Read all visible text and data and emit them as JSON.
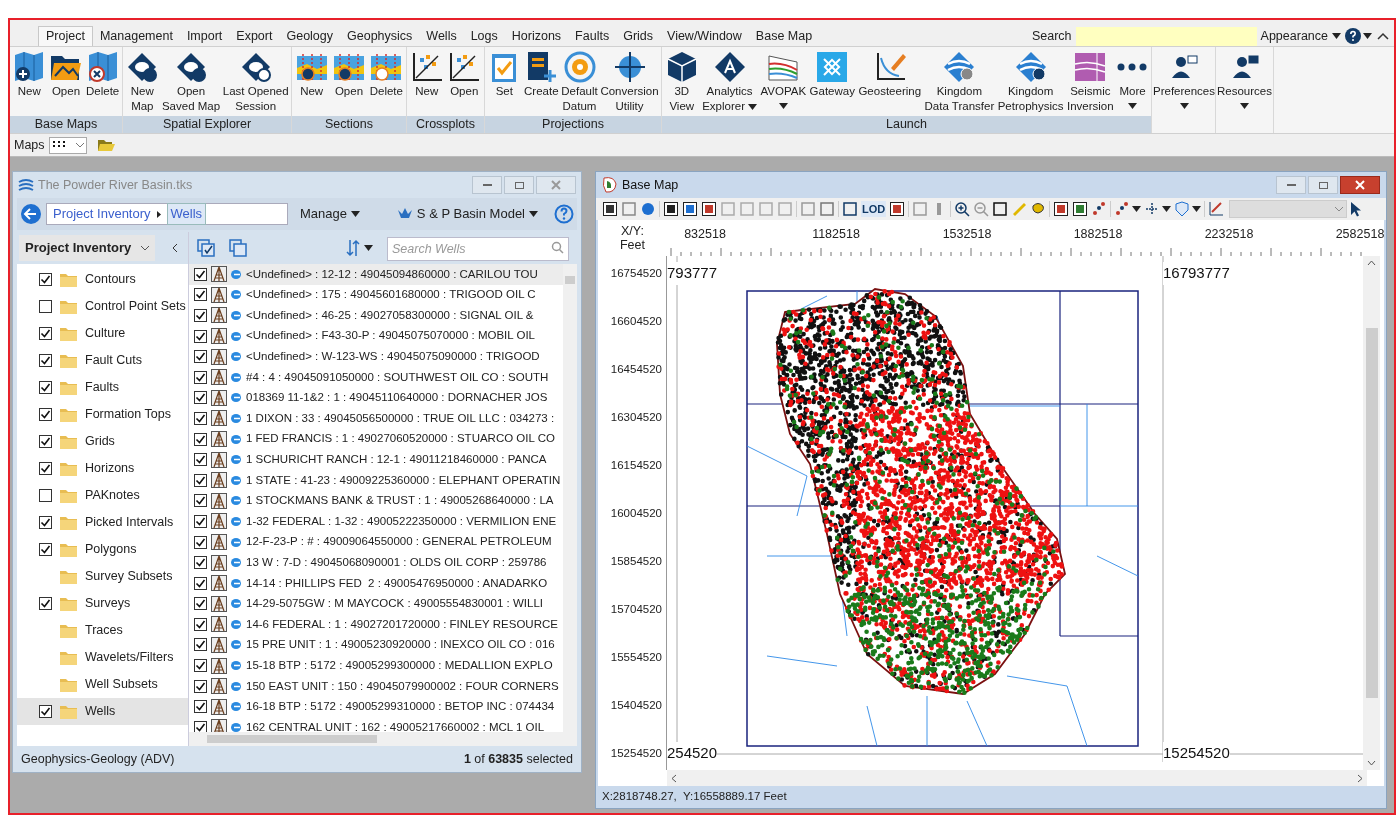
{
  "menu_tabs": [
    {
      "label": "Project",
      "selected": true
    },
    {
      "label": "Management",
      "selected": false
    },
    {
      "label": "Import",
      "selected": false
    },
    {
      "label": "Export",
      "selected": false
    },
    {
      "label": "Geology",
      "selected": false
    },
    {
      "label": "Geophysics",
      "selected": false
    },
    {
      "label": "Wells",
      "selected": false
    },
    {
      "label": "Logs",
      "selected": false
    },
    {
      "label": "Horizons",
      "selected": false
    },
    {
      "label": "Faults",
      "selected": false
    },
    {
      "label": "Grids",
      "selected": false
    },
    {
      "label": "View/Window",
      "selected": false
    },
    {
      "label": "Base Map",
      "selected": false
    }
  ],
  "search": {
    "label": "Search"
  },
  "appearance": "Appearance",
  "ribbon_groups": [
    {
      "label": "Base Maps",
      "buttons": [
        {
          "lines": [
            "New"
          ],
          "dropdown": false
        },
        {
          "lines": [
            "Open"
          ],
          "dropdown": false
        },
        {
          "lines": [
            "Delete"
          ],
          "dropdown": false
        }
      ]
    },
    {
      "label": "Spatial Explorer",
      "buttons": [
        {
          "lines": [
            "New",
            "Map"
          ],
          "dropdown": false
        },
        {
          "lines": [
            "Open",
            "Saved Map"
          ],
          "dropdown": false
        },
        {
          "lines": [
            "Last Opened",
            "Session"
          ],
          "dropdown": false
        }
      ]
    },
    {
      "label": "Sections",
      "buttons": [
        {
          "lines": [
            "New"
          ],
          "dropdown": false
        },
        {
          "lines": [
            "Open"
          ],
          "dropdown": false
        },
        {
          "lines": [
            "Delete"
          ],
          "dropdown": false
        }
      ]
    },
    {
      "label": "Crossplots",
      "buttons": [
        {
          "lines": [
            "New"
          ],
          "dropdown": false
        },
        {
          "lines": [
            "Open"
          ],
          "dropdown": false
        }
      ]
    },
    {
      "label": "Projections",
      "buttons": [
        {
          "lines": [
            "Set"
          ],
          "dropdown": false
        },
        {
          "lines": [
            "Create"
          ],
          "dropdown": false
        },
        {
          "lines": [
            "Default",
            "Datum"
          ],
          "dropdown": false
        },
        {
          "lines": [
            "Conversion",
            "Utility"
          ],
          "dropdown": false
        }
      ]
    },
    {
      "label": "Launch",
      "buttons": [
        {
          "lines": [
            "3D",
            "View"
          ],
          "dropdown": false
        },
        {
          "lines": [
            "Analytics",
            "Explorer"
          ],
          "dropdown": true
        },
        {
          "lines": [
            "AVOPAK"
          ],
          "dropdown": true
        },
        {
          "lines": [
            "Gateway"
          ],
          "dropdown": false
        },
        {
          "lines": [
            "Geosteering"
          ],
          "dropdown": false
        },
        {
          "lines": [
            "Kingdom",
            "Data Transfer"
          ],
          "dropdown": false
        },
        {
          "lines": [
            "Kingdom",
            "Petrophysics"
          ],
          "dropdown": false
        },
        {
          "lines": [
            "Seismic",
            "Inversion"
          ],
          "dropdown": false
        },
        {
          "lines": [
            "More"
          ],
          "dropdown": true
        }
      ]
    },
    {
      "buttons": [
        {
          "lines": [
            "Preferences"
          ],
          "dropdown": true
        }
      ]
    },
    {
      "buttons": [
        {
          "lines": [
            "Resources"
          ],
          "dropdown": true
        }
      ]
    }
  ],
  "maps_bar": {
    "label": "Maps"
  },
  "inventory_window": {
    "title": "The Powder River Basin.tks",
    "breadcrumb": [
      "Project Inventory",
      "Wells"
    ],
    "manage": "Manage",
    "model": "S & P Basin Model",
    "tree_header": "Project Inventory",
    "search_placeholder": "Search Wells",
    "categories": [
      {
        "label": "Contours",
        "kind": "checkbox",
        "checked": true,
        "selected": false
      },
      {
        "label": "Control Point Sets",
        "kind": "checkbox",
        "checked": false,
        "selected": false
      },
      {
        "label": "Culture",
        "kind": "checkbox",
        "checked": true,
        "selected": false
      },
      {
        "label": "Fault Cuts",
        "kind": "checkbox",
        "checked": true,
        "selected": false
      },
      {
        "label": "Faults",
        "kind": "checkbox",
        "checked": true,
        "selected": false
      },
      {
        "label": "Formation Tops",
        "kind": "checkbox",
        "checked": true,
        "selected": false
      },
      {
        "label": "Grids",
        "kind": "checkbox",
        "checked": true,
        "selected": false
      },
      {
        "label": "Horizons",
        "kind": "checkbox",
        "checked": true,
        "selected": false
      },
      {
        "label": "PAKnotes",
        "kind": "checkbox",
        "checked": false,
        "selected": false
      },
      {
        "label": "Picked Intervals",
        "kind": "checkbox",
        "checked": true,
        "selected": false
      },
      {
        "label": "Polygons",
        "kind": "checkbox",
        "checked": true,
        "selected": false
      },
      {
        "label": "Survey Subsets",
        "kind": "plain",
        "selected": false
      },
      {
        "label": "Surveys",
        "kind": "checkbox",
        "checked": true,
        "selected": false
      },
      {
        "label": "Traces",
        "kind": "plain",
        "selected": false
      },
      {
        "label": "Wavelets/Filters",
        "kind": "plain",
        "selected": false
      },
      {
        "label": "Well Subsets",
        "kind": "plain",
        "selected": false
      },
      {
        "label": "Wells",
        "kind": "checkbox",
        "checked": true,
        "selected": true
      }
    ],
    "wells": [
      {
        "text": "<Undefined> : 12-12 : 49045094860000 : CARILOU TOU",
        "checked": true,
        "selected": true
      },
      {
        "text": "<Undefined> : 175 : 49045601680000 : TRIGOOD OIL C",
        "checked": true,
        "selected": false
      },
      {
        "text": "<Undefined> : 46-25 : 49027058300000 : SIGNAL OIL &",
        "checked": true,
        "selected": false
      },
      {
        "text": "<Undefined> : F43-30-P : 49045075070000 : MOBIL OIL",
        "checked": true,
        "selected": false
      },
      {
        "text": "<Undefined> : W-123-WS : 49045075090000 : TRIGOOD",
        "checked": true,
        "selected": false
      },
      {
        "text": "#4 : 4 : 49045091050000 : SOUTHWEST OIL CO : SOUTH",
        "checked": true,
        "selected": false
      },
      {
        "text": "018369 11-1&2 : 1 : 49045110640000 : DORNACHER JOS",
        "checked": true,
        "selected": false
      },
      {
        "text": "1 DIXON : 33 : 49045056500000 : TRUE OIL LLC : 034273 :",
        "checked": true,
        "selected": false
      },
      {
        "text": "1 FED FRANCIS : 1 : 49027060520000 : STUARCO OIL CO",
        "checked": true,
        "selected": false
      },
      {
        "text": "1 SCHURICHT RANCH : 12-1 : 49011218460000 : PANCA",
        "checked": true,
        "selected": false
      },
      {
        "text": "1 STATE : 41-23 : 49009225360000 : ELEPHANT OPERATIN",
        "checked": true,
        "selected": false
      },
      {
        "text": "1 STOCKMANS BANK & TRUST : 1 : 49005268640000 : LA",
        "checked": true,
        "selected": false
      },
      {
        "text": "1-32 FEDERAL : 1-32 : 49005222350000 : VERMILION ENE",
        "checked": true,
        "selected": false
      },
      {
        "text": "12-F-23-P : # : 49009064550000 : GENERAL PETROLEUM",
        "checked": true,
        "selected": false
      },
      {
        "text": "13 W : 7-D : 49045068090001 : OLDS OIL CORP : 259786",
        "checked": true,
        "selected": false
      },
      {
        "text": "14-14 : PHILLIPS FED  2 : 49005476950000 : ANADARKO",
        "checked": true,
        "selected": false
      },
      {
        "text": "14-29-5075GW : M MAYCOCK : 49005554830001 : WILLI",
        "checked": true,
        "selected": false
      },
      {
        "text": "14-6 FEDERAL : 1 : 49027201720000 : FINLEY RESOURCE",
        "checked": true,
        "selected": false
      },
      {
        "text": "15 PRE UNIT : 1 : 49005230920000 : INEXCO OIL CO : 016",
        "checked": true,
        "selected": false
      },
      {
        "text": "15-18 BTP : 5172 : 49005299300000 : MEDALLION EXPLO",
        "checked": true,
        "selected": false
      },
      {
        "text": "150 EAST UNIT : 150 : 49045079900002 : FOUR CORNERS",
        "checked": true,
        "selected": false
      },
      {
        "text": "16-18 BTP : 5172 : 49005299310000 : BETOP INC : 074434",
        "checked": true,
        "selected": false
      },
      {
        "text": "162 CENTRAL UNIT : 162 : 49005217660002 : MCL 1 OIL",
        "checked": true,
        "selected": false
      }
    ],
    "status_left": "Geophysics-Geology (ADV)",
    "status_right": "**1** of **63835** selected"
  },
  "map_window": {
    "title": "Base Map",
    "toolbar_text": "LOD",
    "axis_label": [
      "X/Y:",
      "Feet"
    ],
    "x_ticks": [
      "832518",
      "1182518",
      "1532518",
      "1882518",
      "2232518",
      "2582518"
    ],
    "y_ticks": [
      "16754520",
      "16604520",
      "16454520",
      "16304520",
      "16154520",
      "16004520",
      "15854520",
      "15704520",
      "15554520",
      "15404520",
      "15254520"
    ],
    "corner_labels": [
      "793777",
      "16793777",
      "254520",
      "15254520"
    ],
    "status": "X:2818748.27,  Y:16558889.17 Feet"
  }
}
